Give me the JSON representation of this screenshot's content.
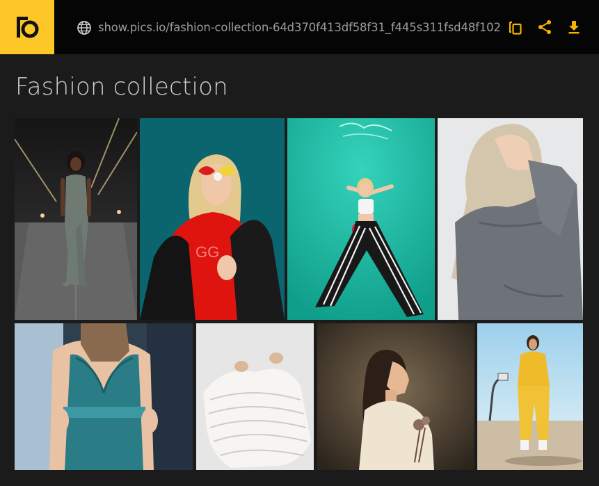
{
  "app": {
    "name": "Pics.io"
  },
  "icons": {
    "logo": "pics-io-logo-icon",
    "globe": "globe-icon",
    "copy": "copy-link-icon",
    "share": "share-icon",
    "download": "download-icon"
  },
  "colors": {
    "brand_yellow": "#fdc727",
    "topbar_bg": "#050505",
    "page_bg": "#1b1b1b",
    "icon_accent": "#f5b400",
    "title_text": "#cfcfcf",
    "url_text": "#9c9c9c"
  },
  "topbar": {
    "url": "show.pics.io/fashion-collection-64d370f413df58f31_f445s311fsd48f102"
  },
  "collection": {
    "title": "Fashion collection",
    "photos": [
      {
        "subject": "woman in grey jumpsuit on night street"
      },
      {
        "subject": "blonde woman with red sunglasses on teal background"
      },
      {
        "subject": "woman in striped pants posing against green neon wall"
      },
      {
        "subject": "blonde woman in grey shirt covering face"
      },
      {
        "subject": "woman in teal satin jumpsuit"
      },
      {
        "subject": "person in white knit sweater"
      },
      {
        "subject": "woman in profile holding dried flowers"
      },
      {
        "subject": "woman in yellow tracksuit on basketball court"
      }
    ]
  }
}
